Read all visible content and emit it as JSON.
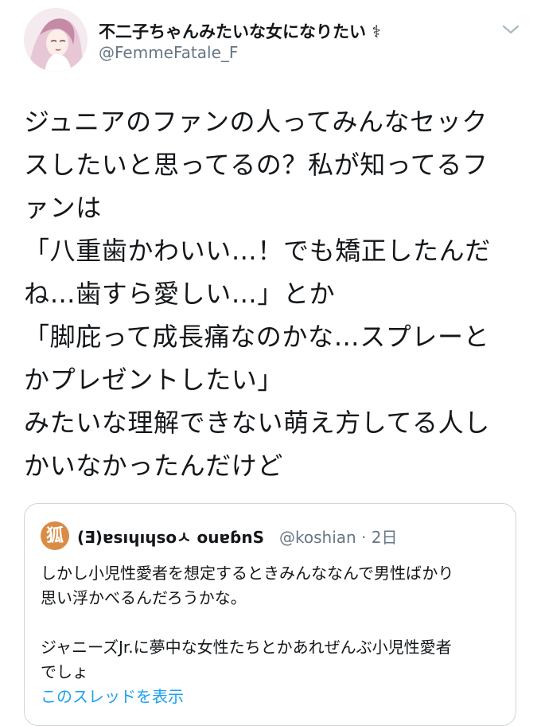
{
  "author": {
    "display_name": "不二子ちゃんみたいな女になりたい",
    "name_emoji": "⚕",
    "handle": "@FemmeFatale_F"
  },
  "tweet": {
    "lines": [
      "ジュニアのファンの人ってみんなセック",
      "スしたいと思ってるの？私が知ってるフ",
      "ァンは",
      "「八重歯かわいい…！でも矯正したんだ",
      "ね…歯すら愛しい…」とか",
      "「脚庇って成長痛なのかな…スプレーと",
      "かプレゼントしたい」",
      "みたいな理解できない萌え方してる人し",
      "かいなかったんだけど"
    ]
  },
  "quoted_tweet": {
    "avatar_glyph": "狐",
    "display_name": "(Ǝ)ɐsıɥıɥsoㅅ ouɐɓnS",
    "handle_time": "@koshian · 2日",
    "lines": [
      "しかし小児性愛者を想定するときみんななんで男性ばかり",
      "思い浮かべるんだろうかな。",
      "",
      "ジャニーズJr.に夢中な女性たちとかあれぜんぶ小児性愛者",
      "でしょ"
    ],
    "thread_link": "このスレッドを表示"
  },
  "colors": {
    "text": "#14171a",
    "secondary": "#657786",
    "link": "#1da1f2",
    "border": "#ccd6dd"
  },
  "icons": [
    "avatar",
    "caret-down-icon",
    "quoted-avatar"
  ]
}
